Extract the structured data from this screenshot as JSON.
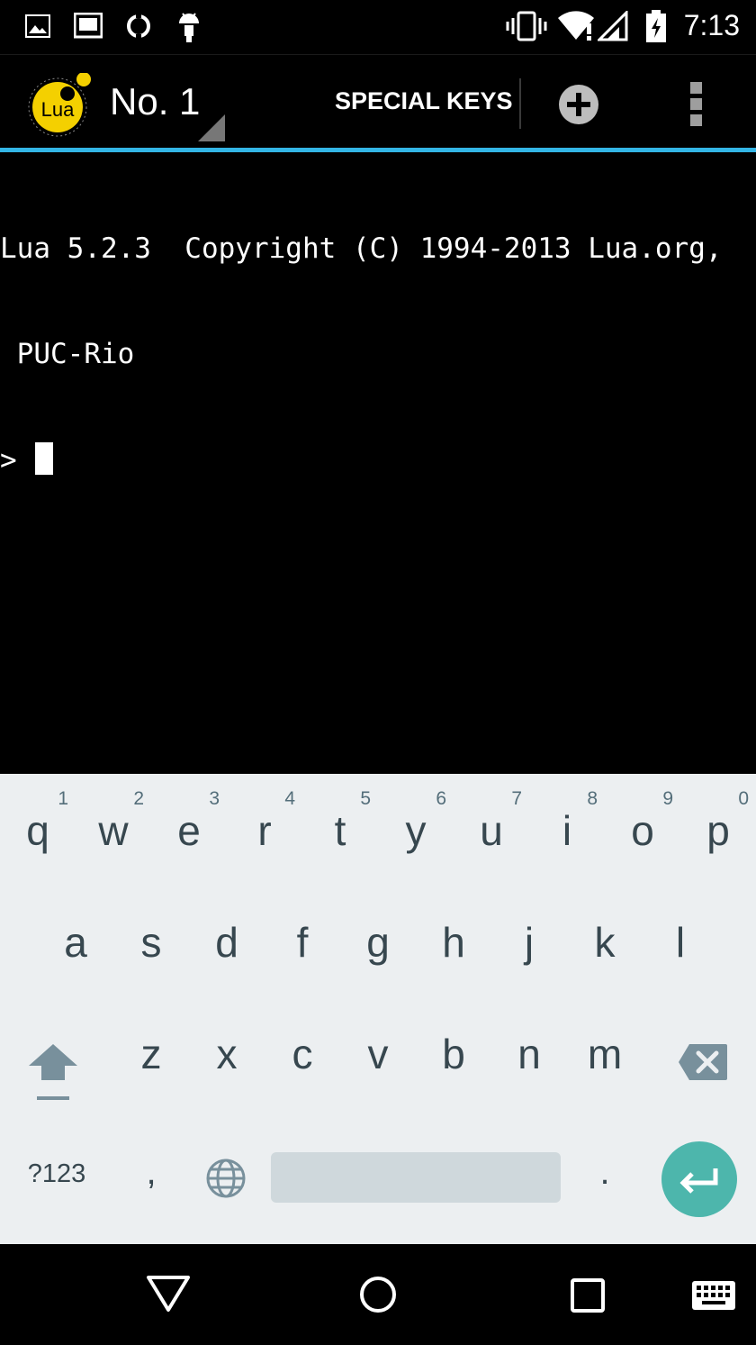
{
  "status_bar": {
    "time": "7:13",
    "icons": [
      "gallery-icon",
      "terminal-notification-icon",
      "sync-icon",
      "android-icon",
      "vibrate-icon",
      "wifi-icon",
      "cell-signal-icon",
      "battery-charging-icon"
    ]
  },
  "action_bar": {
    "title": "No. 1",
    "special_keys_label": "SPECIAL KEYS",
    "logo_text": "Lua",
    "accent_color": "#33b5e5"
  },
  "terminal": {
    "lines": [
      "Lua 5.2.3  Copyright (C) 1994-2013 Lua.org,",
      " PUC-Rio"
    ],
    "prompt": ">"
  },
  "keyboard": {
    "row1": [
      {
        "ch": "q",
        "hint": "1"
      },
      {
        "ch": "w",
        "hint": "2"
      },
      {
        "ch": "e",
        "hint": "3"
      },
      {
        "ch": "r",
        "hint": "4"
      },
      {
        "ch": "t",
        "hint": "5"
      },
      {
        "ch": "y",
        "hint": "6"
      },
      {
        "ch": "u",
        "hint": "7"
      },
      {
        "ch": "i",
        "hint": "8"
      },
      {
        "ch": "o",
        "hint": "9"
      },
      {
        "ch": "p",
        "hint": "0"
      }
    ],
    "row2": [
      "a",
      "s",
      "d",
      "f",
      "g",
      "h",
      "j",
      "k",
      "l"
    ],
    "row3": [
      "z",
      "x",
      "c",
      "v",
      "b",
      "n",
      "m"
    ],
    "symbols_label": "?123",
    "comma": ",",
    "period": ".",
    "enter_color": "#4db6ac"
  }
}
